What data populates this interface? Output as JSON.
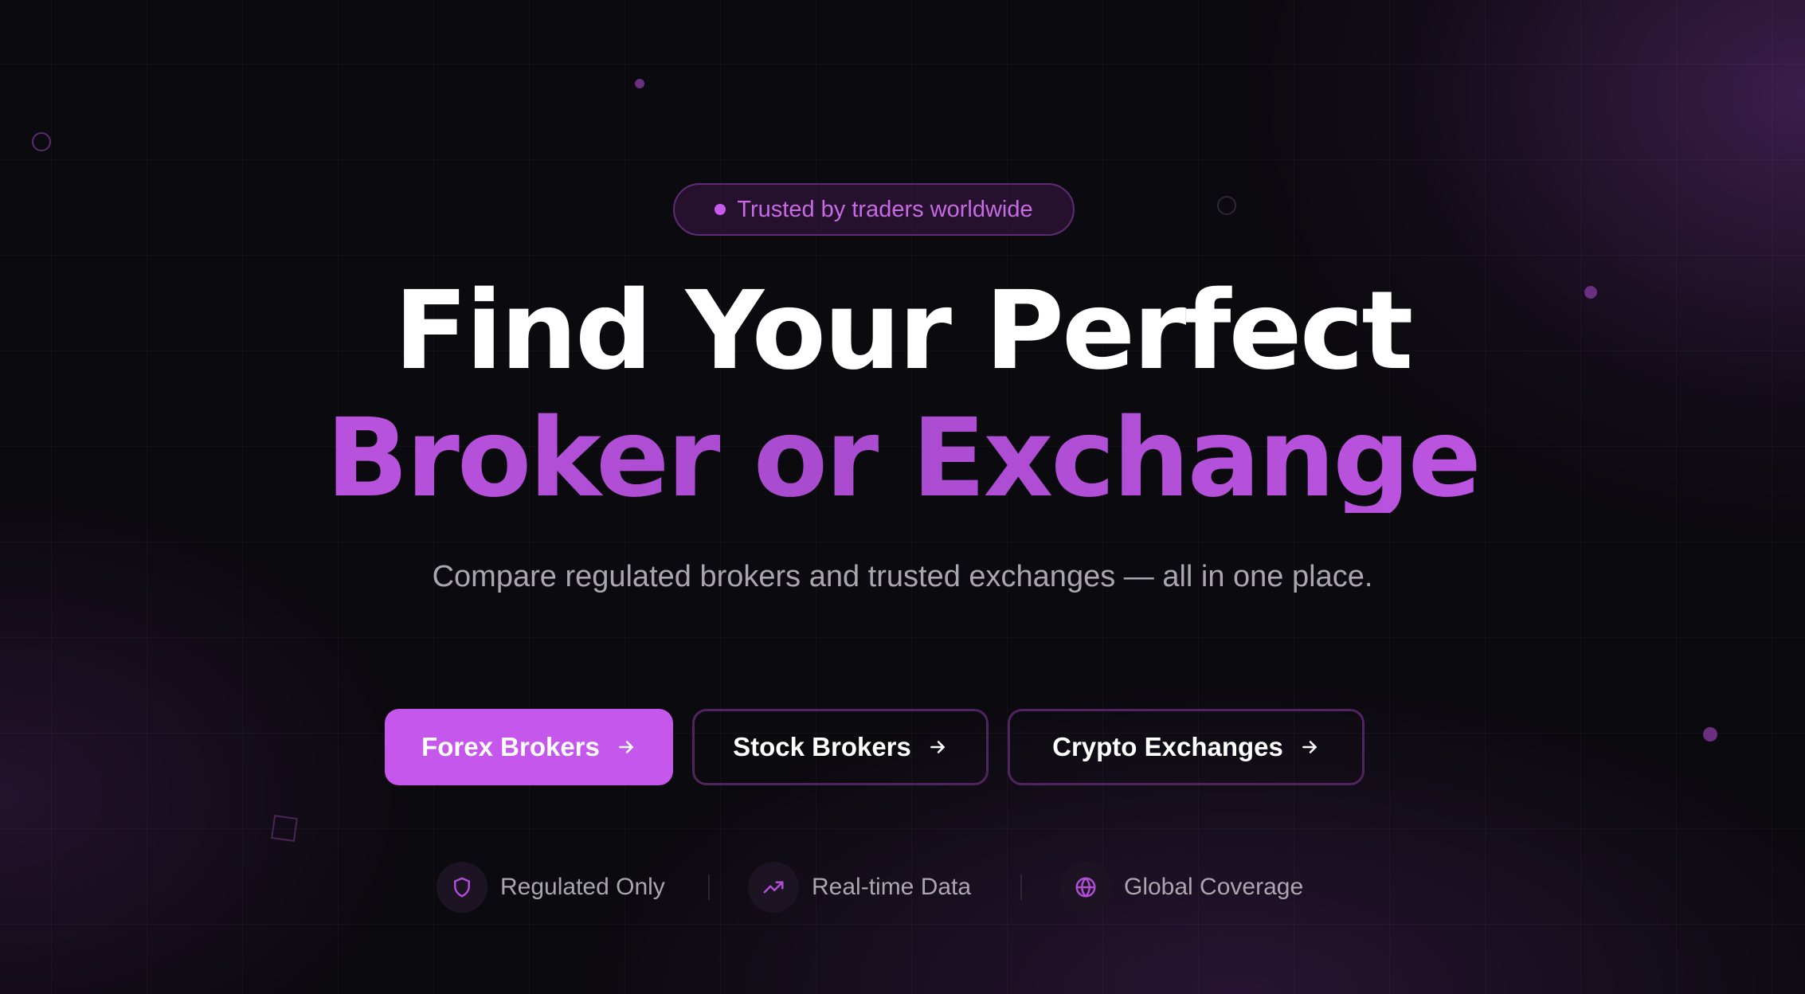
{
  "badge": {
    "text": "Trusted by traders worldwide"
  },
  "hero": {
    "headline_line1": "Find Your Perfect",
    "headline_line2": "Broker or Exchange",
    "subtitle": "Compare regulated brokers and trusted exchanges — all in one place."
  },
  "buttons": {
    "forex": {
      "label": "Forex Brokers",
      "icon": "arrow-right-icon"
    },
    "stock": {
      "label": "Stock Brokers",
      "icon": "arrow-right-icon"
    },
    "crypto": {
      "label": "Crypto Exchanges",
      "icon": "arrow-right-icon"
    }
  },
  "features": [
    {
      "label": "Regulated Only",
      "icon": "shield-icon"
    },
    {
      "label": "Real-time Data",
      "icon": "trending-up-icon"
    },
    {
      "label": "Global Coverage",
      "icon": "globe-icon"
    }
  ],
  "colors": {
    "background": "#0b0a0e",
    "accent": "#c657ec",
    "accent_text": "#c86ae6",
    "headline": "#ffffff",
    "muted_text": "#a9a7ad",
    "outline_border": "#4f2460"
  }
}
